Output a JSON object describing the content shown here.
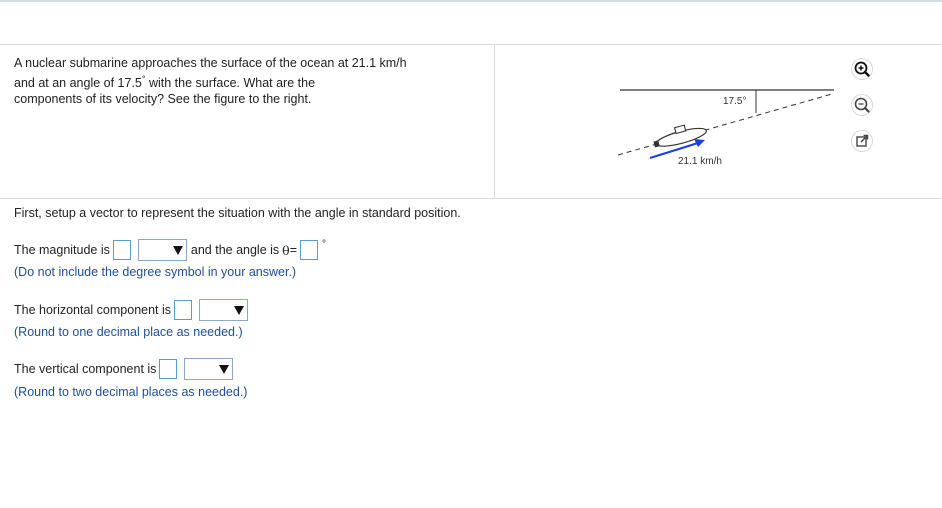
{
  "question": {
    "line1": "A nuclear submarine approaches the surface of the ocean at 21.1 km/h",
    "line2_pre": "and at an angle of 17.5",
    "line2_deg": "°",
    "line2_post": " with the surface. What are the",
    "line3": "components of its velocity? See the figure to the right."
  },
  "figure": {
    "angle_label": "17.5°",
    "speed_label": "21.1 km/h",
    "arrow_color": "#1a3ee8"
  },
  "tools": [
    "zoom-in-icon",
    "zoom-out-icon",
    "popout-icon"
  ],
  "setup": "First, setup a vector to represent the situation with the angle in standard position.",
  "magnitude": {
    "label": "The magnitude is",
    "mid_label": "and the angle is",
    "theta": "θ",
    "equals": "=",
    "degree": "°",
    "hint": "(Do not include the degree symbol in your answer.)"
  },
  "horizontal": {
    "label": "The horizontal component is",
    "hint": "(Round to one decimal place as needed.)"
  },
  "vertical": {
    "label": "The vertical component is",
    "hint": "(Round to two decimal places as needed.)"
  },
  "colors": {
    "hint": "#1f4e99",
    "input_border": "#5b9bd5"
  }
}
